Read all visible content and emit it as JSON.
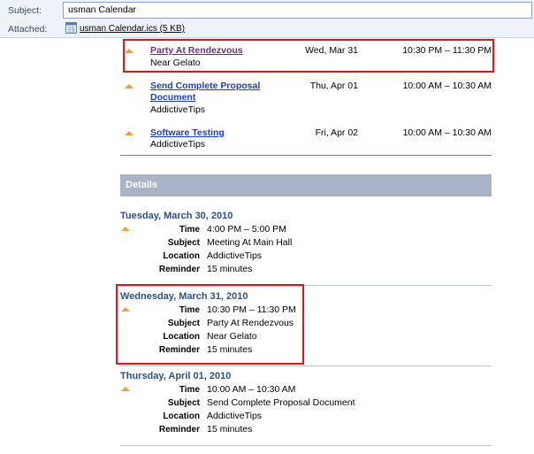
{
  "header": {
    "subject_label": "Subject:",
    "subject_value": "usman Calendar",
    "attached_label": "Attached:",
    "attachment_name": "usman Calendar.ics (5 KB)"
  },
  "appointments": [
    {
      "title": "Party At Rendezvous",
      "location": "Near Gelato",
      "date": "Wed, Mar 31",
      "time": "10:30 PM – 11:30 PM"
    },
    {
      "title_line1": "Send Complete Proposal",
      "title_line2": "Document",
      "location": "AddictiveTips",
      "date": "Thu, Apr 01",
      "time": "10:00 AM – 10:30 AM"
    },
    {
      "title": "Software Testing",
      "location": "AddictiveTips",
      "date": "Fri, Apr 02",
      "time": "10:00 AM – 10:30 AM"
    }
  ],
  "details": {
    "heading": "Details",
    "labels": {
      "time": "Time",
      "subject": "Subject",
      "location": "Location",
      "reminder": "Reminder"
    },
    "days": [
      {
        "heading": "Tuesday, March 30, 2010",
        "time": "4:00 PM – 5:00 PM",
        "subject": "Meeting At Main Hall",
        "location": "AddictiveTips",
        "reminder": "15 minutes"
      },
      {
        "heading": "Wednesday, March 31, 2010",
        "time": "10:30 PM – 11:30 PM",
        "subject": "Party At Rendezvous",
        "location": "Near Gelato",
        "reminder": "15 minutes"
      },
      {
        "heading": "Thursday, April 01, 2010",
        "time": "10:00 AM – 10:30 AM",
        "subject": "Send Complete Proposal Document",
        "location": "AddictiveTips",
        "reminder": "15 minutes"
      }
    ]
  },
  "icons": {
    "attachment": "ics-file-icon",
    "reminder": "reminder-triangle-icon"
  },
  "colors": {
    "highlight": "#e0141c",
    "link": "#1f3fb5",
    "visited_link": "#6f2a8f",
    "day_heading": "#2f4f80",
    "details_bar": "#a9b4c6"
  }
}
